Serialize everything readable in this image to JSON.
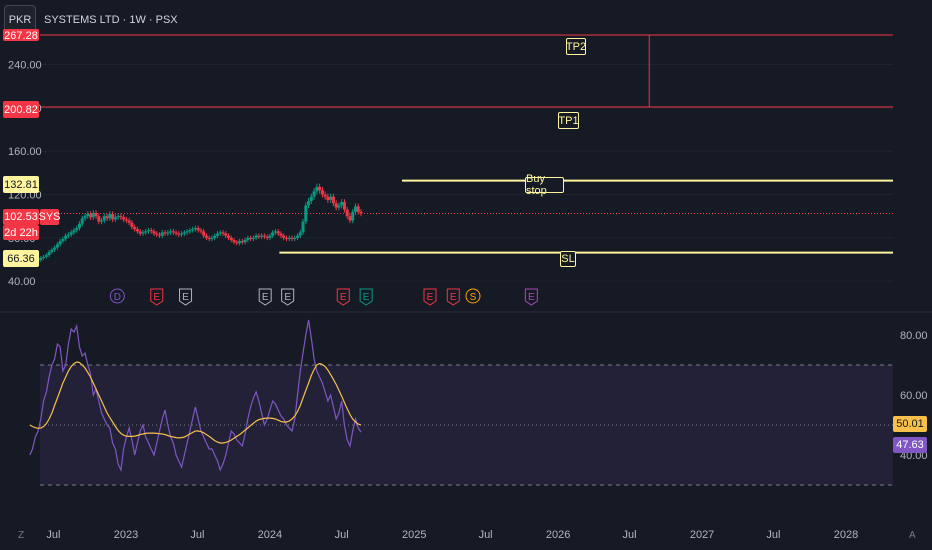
{
  "header": {
    "currency": "PKR",
    "symbol_title": "SYSTEMS LTD · 1W · PSX"
  },
  "colors": {
    "background": "#161a25",
    "candle_up": "#089981",
    "candle_down": "#f23645",
    "level_red": "#f23645",
    "level_yellow": "#fff59d",
    "rsi_line": "#7e57c2",
    "rsi_ma": "#f7c04a",
    "rsi_band": "#2a2540",
    "text": "#b2b5be"
  },
  "price_axis": {
    "ticks": [
      "240.00",
      "200.00",
      "160.00",
      "120.00",
      "80.00",
      "40.00"
    ],
    "tick_values": [
      240,
      200,
      160,
      120,
      80,
      40
    ],
    "top_cut_label": "267.28",
    "labels": {
      "tp1_price": "200.82",
      "buy_stop_price": "132.81",
      "last_price": "102.53",
      "last_symbol": "SYS",
      "countdown": "2d 22h",
      "sl_price": "66.36"
    }
  },
  "rsi_axis": {
    "ticks": [
      "80.00",
      "60.00",
      "40.00"
    ],
    "tick_values": [
      80,
      60,
      40
    ],
    "ma_value_label": "50.01",
    "rsi_value_label": "47.63"
  },
  "time_axis": {
    "labels": [
      "Jul",
      "2023",
      "Jul",
      "2024",
      "Jul",
      "2025",
      "Jul",
      "2026",
      "Jul",
      "2027",
      "Jul",
      "2028"
    ],
    "left_button": "Z",
    "right_button": "A"
  },
  "annotations": {
    "tp2": "TP2",
    "tp1": "TP1",
    "buy_stop": "Buy stop",
    "sl": "SL"
  },
  "event_markers": [
    {
      "letter": "D",
      "kind": "dividend",
      "color": "#7e57c2",
      "date": "2022-12-10"
    },
    {
      "letter": "E",
      "kind": "earnings",
      "color": "#f23645",
      "date": "2023-03-20"
    },
    {
      "letter": "E",
      "kind": "earnings",
      "color": "#b2b5be",
      "date": "2023-06-01"
    },
    {
      "letter": "E",
      "kind": "earnings",
      "color": "#b2b5be",
      "date": "2023-12-20"
    },
    {
      "letter": "E",
      "kind": "earnings",
      "color": "#b2b5be",
      "date": "2024-02-15"
    },
    {
      "letter": "E",
      "kind": "earnings",
      "color": "#f23645",
      "date": "2024-07-05"
    },
    {
      "letter": "E",
      "kind": "earnings",
      "color": "#089981",
      "date": "2024-09-01"
    },
    {
      "letter": "E",
      "kind": "earnings",
      "color": "#f23645",
      "date": "2025-02-10"
    },
    {
      "letter": "E",
      "kind": "earnings",
      "color": "#f23645",
      "date": "2025-04-10"
    },
    {
      "letter": "S",
      "kind": "split",
      "color": "#f7a600",
      "date": "2025-05-30"
    },
    {
      "letter": "E",
      "kind": "earnings",
      "color": "#ab47bc",
      "date": "2025-10-25"
    }
  ],
  "chart_data": {
    "type": "candlestick",
    "title": "SYSTEMS LTD · 1W · PSX",
    "price_range": [
      18,
      267.28
    ],
    "levels": {
      "tp2": 267.28,
      "tp1": 200.82,
      "buy_stop": 132.81,
      "sl": 66.36,
      "last": 102.53
    },
    "closes": {
      "start_date": "2022-05-02",
      "interval_days": 7,
      "values": [
        56,
        58.5,
        60,
        59.5,
        61.5,
        62.5,
        64,
        67,
        69,
        71,
        74,
        77,
        79,
        82,
        83,
        85,
        87,
        89,
        93,
        98,
        100,
        102,
        99,
        103,
        100,
        95,
        96,
        100,
        98,
        102,
        97,
        99,
        100,
        99,
        97,
        96,
        94,
        90,
        88,
        86,
        84,
        85,
        86,
        87,
        86,
        84,
        83,
        82,
        85,
        84,
        85,
        86,
        85,
        84,
        83,
        84,
        85,
        86,
        87,
        88,
        89,
        87,
        86,
        82,
        80,
        79,
        80,
        82,
        84,
        85,
        84,
        82,
        80,
        78,
        76,
        75,
        77,
        76,
        78,
        80,
        79,
        80,
        82,
        81,
        82,
        81,
        80,
        82,
        85,
        86,
        84,
        82,
        80,
        79,
        80,
        79,
        80,
        82,
        85,
        95,
        110,
        114,
        118,
        123,
        127,
        124,
        120,
        118,
        115,
        118,
        112,
        108,
        110,
        113,
        106,
        100,
        96,
        104,
        109,
        104,
        102.53
      ]
    },
    "rsi": {
      "start_date": "2022-05-02",
      "interval_days": 7,
      "rsi_values": [
        40,
        42,
        46,
        48,
        52,
        58,
        61,
        66,
        70,
        72,
        77,
        76,
        68,
        70,
        77,
        82,
        81,
        83,
        76,
        73,
        74,
        70,
        67,
        60,
        62,
        58,
        54,
        52,
        50,
        49,
        44,
        42,
        37,
        35,
        42,
        46,
        49,
        45,
        40,
        44,
        48,
        50,
        46,
        44,
        42,
        40,
        44,
        48,
        52,
        55,
        50,
        46,
        44,
        40,
        38,
        36,
        40,
        44,
        48,
        52,
        56,
        52,
        48,
        46,
        44,
        42,
        42,
        40,
        38,
        35,
        37,
        40,
        44,
        48,
        47,
        45,
        44,
        43,
        47,
        52,
        56,
        59,
        61,
        58,
        54,
        50,
        52,
        55,
        58,
        57,
        55,
        53,
        52,
        50,
        49,
        48,
        52,
        60,
        68,
        74,
        80,
        85,
        79,
        72,
        68,
        66,
        64,
        61,
        58,
        60,
        56,
        52,
        54,
        58,
        50,
        45,
        43,
        48,
        52,
        49,
        47.63
      ],
      "ma_values": [
        50,
        49.5,
        49.1,
        48.9,
        49,
        49.5,
        50.5,
        52,
        54,
        56.5,
        59,
        61.5,
        64,
        66,
        68,
        69.5,
        70.5,
        71,
        70.8,
        70,
        69,
        67.5,
        66,
        64,
        62,
        60,
        58,
        56,
        54,
        52.5,
        51,
        49.5,
        48.2,
        47.2,
        46.6,
        46.3,
        46.2,
        46.2,
        46.3,
        46.5,
        46.8,
        47,
        47.2,
        47.3,
        47.3,
        47.3,
        47.2,
        47.1,
        47,
        46.8,
        46.5,
        46.2,
        46,
        45.8,
        45.7,
        45.8,
        46,
        46.5,
        47,
        47.5,
        48,
        48,
        47.8,
        47.4,
        46.8,
        46.2,
        45.5,
        44.8,
        44.3,
        44,
        44,
        44.2,
        44.5,
        45,
        45.6,
        46.2,
        46.8,
        47.5,
        48.3,
        49,
        49.8,
        50.6,
        51.3,
        51.8,
        52,
        52.2,
        52.3,
        52.3,
        52.2,
        52,
        51.6,
        51.2,
        51,
        51,
        51.3,
        52,
        53,
        54.5,
        56.5,
        59,
        61.5,
        64,
        66.5,
        68.5,
        70,
        70.5,
        70.2,
        69.5,
        68.3,
        66.8,
        65.2,
        63.5,
        61.6,
        59.6,
        57.5,
        55.4,
        53.5,
        52,
        51,
        50.3,
        50.01
      ]
    },
    "rsi_range": [
      20,
      85
    ],
    "rsi_band": [
      70,
      30
    ],
    "rsi_midline": 50
  }
}
